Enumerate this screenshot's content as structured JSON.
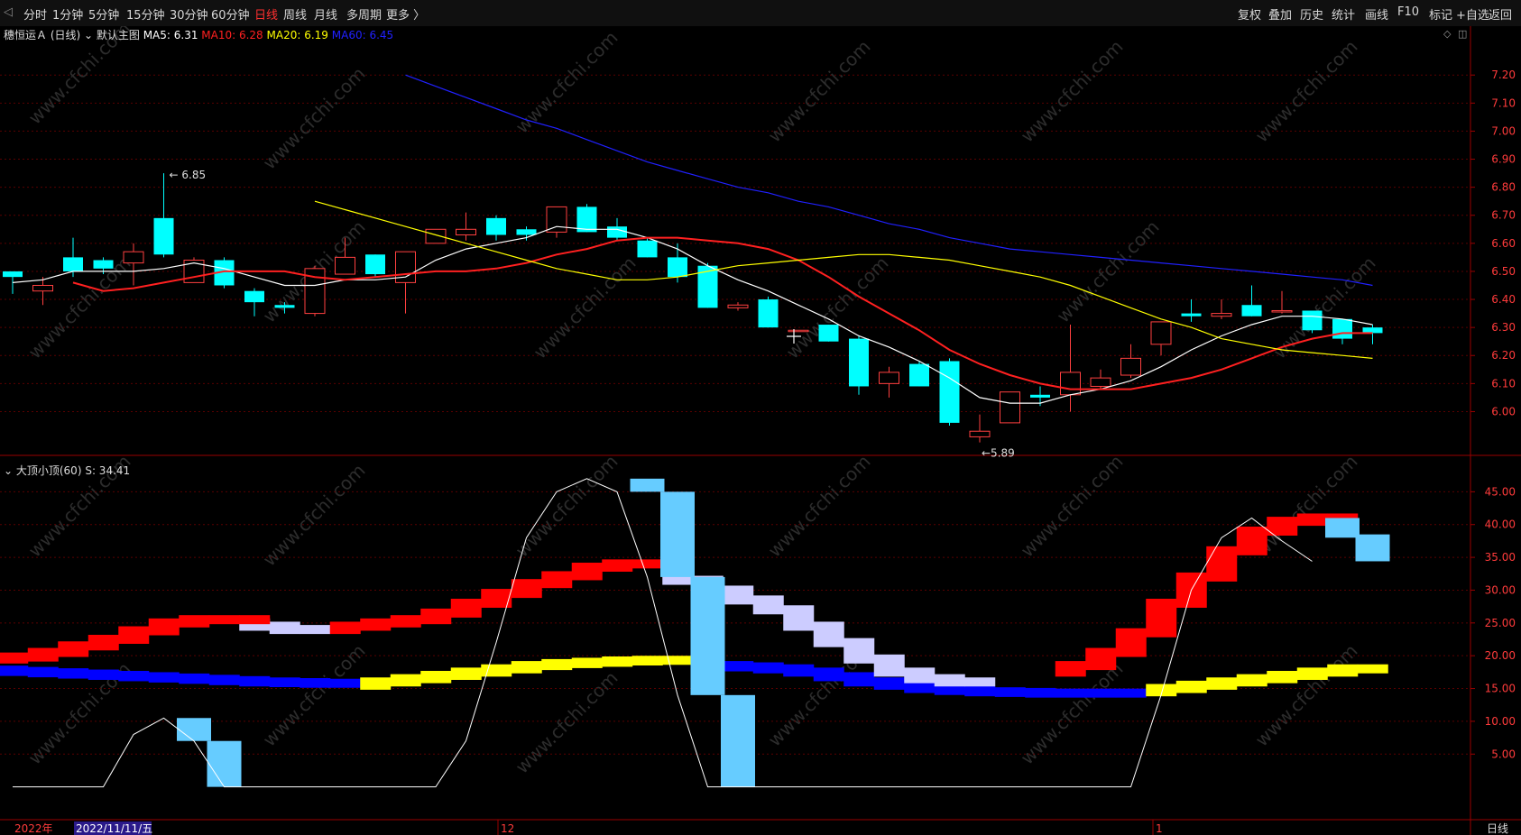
{
  "toolbar": {
    "left_items": [
      "分时",
      "1分钟",
      "5分钟",
      "15分钟",
      "30分钟",
      "60分钟",
      "日线",
      "周线",
      "月线",
      "多周期",
      "更多 〉"
    ],
    "active": "日线",
    "right_items": [
      "复权",
      "叠加",
      "历史",
      "统计",
      "画线",
      "F10",
      "标记",
      "+自选",
      "返回"
    ]
  },
  "main_header": {
    "name": "穗恒运Ａ (日线)",
    "template": "默认主图",
    "ma5": "MA5: 6.31",
    "ma10": "MA10: 6.28",
    "ma20": "MA20: 6.19",
    "ma60": "MA60: 6.45"
  },
  "sub_header": {
    "name": "大顶小顶(60)",
    "value": "S: 34.41"
  },
  "bottom_bar": {
    "year": "2022年",
    "date": "2022/11/11/五",
    "month_dec": "12",
    "month_jan": "1",
    "period": "日线"
  },
  "watermark": "www.cfchi.com",
  "colors": {
    "up": "#ff4040",
    "down": "#00ffff",
    "ma5": "#ffffff",
    "ma10": "#ff2020",
    "ma20": "#ffff00",
    "ma60": "#2020ff",
    "grid": "#5a0000",
    "axis": "#9a0000",
    "s_line": "#ffffff",
    "s_bar": "#66ccff",
    "red_band": "#ff0000",
    "lav_band": "#ccccff",
    "yel_band": "#ffff00",
    "blu_band": "#0000ff"
  },
  "chart_data": [
    {
      "type": "candlestick",
      "y_ticks": [
        6.0,
        6.1,
        6.2,
        6.3,
        6.4,
        6.5,
        6.6,
        6.7,
        6.8,
        6.9,
        7.0,
        7.1,
        7.2
      ],
      "ylim": [
        5.86,
        7.31
      ],
      "annotations": [
        {
          "label": "6.85",
          "index": 5,
          "value": 6.85
        },
        {
          "label": "5.89",
          "index": 32,
          "value": 5.89
        }
      ],
      "candles": [
        {
          "o": 6.5,
          "h": 6.5,
          "l": 6.42,
          "c": 6.48
        },
        {
          "o": 6.43,
          "h": 6.48,
          "l": 6.38,
          "c": 6.45
        },
        {
          "o": 6.55,
          "h": 6.62,
          "l": 6.48,
          "c": 6.5
        },
        {
          "o": 6.54,
          "h": 6.55,
          "l": 6.49,
          "c": 6.51
        },
        {
          "o": 6.53,
          "h": 6.6,
          "l": 6.45,
          "c": 6.57
        },
        {
          "o": 6.69,
          "h": 6.85,
          "l": 6.55,
          "c": 6.56
        },
        {
          "o": 6.46,
          "h": 6.55,
          "l": 6.46,
          "c": 6.54
        },
        {
          "o": 6.54,
          "h": 6.55,
          "l": 6.44,
          "c": 6.45
        },
        {
          "o": 6.43,
          "h": 6.44,
          "l": 6.34,
          "c": 6.39
        },
        {
          "o": 6.38,
          "h": 6.39,
          "l": 6.35,
          "c": 6.37
        },
        {
          "o": 6.35,
          "h": 6.52,
          "l": 6.34,
          "c": 6.51
        },
        {
          "o": 6.49,
          "h": 6.62,
          "l": 6.49,
          "c": 6.55
        },
        {
          "o": 6.56,
          "h": 6.56,
          "l": 6.48,
          "c": 6.49
        },
        {
          "o": 6.46,
          "h": 6.57,
          "l": 6.35,
          "c": 6.57
        },
        {
          "o": 6.6,
          "h": 6.65,
          "l": 6.6,
          "c": 6.65
        },
        {
          "o": 6.63,
          "h": 6.71,
          "l": 6.61,
          "c": 6.65
        },
        {
          "o": 6.69,
          "h": 6.7,
          "l": 6.61,
          "c": 6.63
        },
        {
          "o": 6.65,
          "h": 6.66,
          "l": 6.61,
          "c": 6.63
        },
        {
          "o": 6.64,
          "h": 6.73,
          "l": 6.62,
          "c": 6.73
        },
        {
          "o": 6.73,
          "h": 6.74,
          "l": 6.64,
          "c": 6.64
        },
        {
          "o": 6.66,
          "h": 6.69,
          "l": 6.61,
          "c": 6.62
        },
        {
          "o": 6.61,
          "h": 6.62,
          "l": 6.55,
          "c": 6.55
        },
        {
          "o": 6.55,
          "h": 6.6,
          "l": 6.46,
          "c": 6.48
        },
        {
          "o": 6.52,
          "h": 6.53,
          "l": 6.37,
          "c": 6.37
        },
        {
          "o": 6.37,
          "h": 6.39,
          "l": 6.36,
          "c": 6.38
        },
        {
          "o": 6.4,
          "h": 6.41,
          "l": 6.3,
          "c": 6.3
        },
        {
          "o": 6.29,
          "h": 6.29,
          "l": 6.29,
          "c": 6.29
        },
        {
          "o": 6.31,
          "h": 6.31,
          "l": 6.25,
          "c": 6.25
        },
        {
          "o": 6.26,
          "h": 6.27,
          "l": 6.06,
          "c": 6.09
        },
        {
          "o": 6.1,
          "h": 6.16,
          "l": 6.05,
          "c": 6.14
        },
        {
          "o": 6.17,
          "h": 6.18,
          "l": 6.09,
          "c": 6.09
        },
        {
          "o": 6.18,
          "h": 6.19,
          "l": 5.95,
          "c": 5.96
        },
        {
          "o": 5.91,
          "h": 5.99,
          "l": 5.89,
          "c": 5.93
        },
        {
          "o": 5.96,
          "h": 6.07,
          "l": 5.96,
          "c": 6.07
        },
        {
          "o": 6.06,
          "h": 6.09,
          "l": 6.02,
          "c": 6.05
        },
        {
          "o": 6.06,
          "h": 6.31,
          "l": 6.0,
          "c": 6.14
        },
        {
          "o": 6.09,
          "h": 6.15,
          "l": 6.08,
          "c": 6.12
        },
        {
          "o": 6.13,
          "h": 6.24,
          "l": 6.12,
          "c": 6.19
        },
        {
          "o": 6.24,
          "h": 6.32,
          "l": 6.2,
          "c": 6.32
        },
        {
          "o": 6.35,
          "h": 6.4,
          "l": 6.32,
          "c": 6.34
        },
        {
          "o": 6.34,
          "h": 6.4,
          "l": 6.33,
          "c": 6.35
        },
        {
          "o": 6.38,
          "h": 6.45,
          "l": 6.34,
          "c": 6.34
        },
        {
          "o": 6.36,
          "h": 6.43,
          "l": 6.35,
          "c": 6.36
        },
        {
          "o": 6.36,
          "h": 6.36,
          "l": 6.28,
          "c": 6.29
        },
        {
          "o": 6.33,
          "h": 6.33,
          "l": 6.24,
          "c": 6.26
        },
        {
          "o": 6.3,
          "h": 6.31,
          "l": 6.24,
          "c": 6.28
        }
      ],
      "series": [
        {
          "name": "MA5",
          "values": [
            6.46,
            6.47,
            6.5,
            6.5,
            6.5,
            6.51,
            6.53,
            6.51,
            6.48,
            6.45,
            6.45,
            6.47,
            6.47,
            6.48,
            6.54,
            6.58,
            6.6,
            6.62,
            6.66,
            6.65,
            6.65,
            6.62,
            6.58,
            6.52,
            6.47,
            6.43,
            6.38,
            6.33,
            6.27,
            6.23,
            6.18,
            6.12,
            6.05,
            6.03,
            6.03,
            6.06,
            6.08,
            6.11,
            6.16,
            6.22,
            6.27,
            6.31,
            6.34,
            6.34,
            6.33,
            6.31
          ]
        },
        {
          "name": "MA10",
          "values": [
            6.46,
            6.43,
            6.44,
            6.46,
            6.48,
            6.5,
            6.5,
            6.5,
            6.48,
            6.47,
            6.48,
            6.49,
            6.5,
            6.5,
            6.51,
            6.53,
            6.56,
            6.58,
            6.61,
            6.62,
            6.62,
            6.61,
            6.6,
            6.58,
            6.54,
            6.48,
            6.41,
            6.35,
            6.29,
            6.22,
            6.17,
            6.13,
            6.1,
            6.08,
            6.08,
            6.08,
            6.1,
            6.12,
            6.15,
            6.19,
            6.23,
            6.26,
            6.28,
            6.28
          ]
        },
        {
          "name": "MA20",
          "values": [
            6.75,
            6.72,
            6.69,
            6.66,
            6.63,
            6.6,
            6.57,
            6.54,
            6.51,
            6.49,
            6.47,
            6.47,
            6.48,
            6.5,
            6.52,
            6.53,
            6.54,
            6.55,
            6.56,
            6.56,
            6.55,
            6.54,
            6.52,
            6.5,
            6.48,
            6.45,
            6.41,
            6.37,
            6.33,
            6.3,
            6.26,
            6.24,
            6.22,
            6.21,
            6.2,
            6.19
          ]
        },
        {
          "name": "MA60",
          "values": [
            7.2,
            7.16,
            7.12,
            7.08,
            7.04,
            7.01,
            6.97,
            6.93,
            6.89,
            6.86,
            6.83,
            6.8,
            6.78,
            6.75,
            6.73,
            6.7,
            6.67,
            6.65,
            6.62,
            6.6,
            6.58,
            6.57,
            6.56,
            6.55,
            6.54,
            6.53,
            6.52,
            6.51,
            6.5,
            6.49,
            6.48,
            6.47,
            6.45
          ]
        }
      ]
    },
    {
      "type": "bar+line",
      "title": "大顶小顶(60)",
      "y_ticks": [
        5,
        10,
        15,
        20,
        25,
        30,
        35,
        40,
        45
      ],
      "ylim": [
        -5,
        50
      ],
      "s_line": [
        0,
        0,
        0,
        0,
        8,
        10.5,
        7,
        0,
        0,
        0,
        0,
        0,
        0,
        0,
        0,
        7,
        22,
        38,
        45,
        47,
        45,
        32,
        14,
        0,
        0,
        0,
        0,
        0,
        0,
        0,
        0,
        0,
        0,
        0,
        0,
        0,
        0,
        0,
        14,
        30,
        38,
        41,
        37.5,
        34.4
      ],
      "s_bars": [
        {
          "i": 6,
          "top": 10.5,
          "bottom": 7
        },
        {
          "i": 7,
          "top": 7,
          "bottom": 0
        },
        {
          "i": 21,
          "top": 47,
          "bottom": 45
        },
        {
          "i": 22,
          "top": 45,
          "bottom": 32
        },
        {
          "i": 23,
          "top": 32,
          "bottom": 14
        },
        {
          "i": 24,
          "top": 14,
          "bottom": 0
        },
        {
          "i": 44,
          "top": 41,
          "bottom": 38
        },
        {
          "i": 45,
          "top": 38.5,
          "bottom": 34.4
        }
      ],
      "red_band": [
        19.5,
        19.8,
        20.5,
        21.5,
        22.5,
        23.8,
        25,
        25.5,
        25.5,
        null,
        null,
        24,
        24.5,
        25,
        25.5,
        26.5,
        28,
        29.5,
        31,
        32.2,
        33.5,
        34,
        null,
        null,
        null,
        null,
        null,
        null,
        null,
        null,
        null,
        null,
        null,
        null,
        null,
        17.5,
        18.5,
        20.5,
        23.5,
        28,
        32,
        36,
        39,
        40.5,
        41
      ],
      "lav_band": [
        null,
        null,
        null,
        null,
        null,
        null,
        null,
        null,
        25,
        24.5,
        24,
        null,
        null,
        null,
        null,
        null,
        null,
        null,
        null,
        null,
        null,
        null,
        32.5,
        31.5,
        30,
        28.5,
        27,
        24.5,
        22,
        19.5,
        17.5,
        16.5,
        16
      ],
      "yel_band": [
        null,
        null,
        null,
        null,
        null,
        null,
        null,
        null,
        null,
        null,
        null,
        null,
        15.5,
        16,
        16.5,
        17,
        17.5,
        18,
        18.5,
        18.8,
        19,
        19.2,
        19.3,
        19.3,
        null,
        null,
        null,
        null,
        null,
        null,
        null,
        null,
        null,
        null,
        null,
        null,
        null,
        null,
        14.5,
        15,
        15.5,
        16,
        16.5,
        17,
        17.5,
        18
      ],
      "blu_band": [
        17.8,
        17.6,
        17.4,
        17.2,
        17,
        16.8,
        16.6,
        16.4,
        16.2,
        16,
        15.9,
        15.8,
        15.8,
        null,
        null,
        null,
        null,
        null,
        null,
        null,
        null,
        null,
        null,
        null,
        18.5,
        18.3,
        18,
        17.5,
        16.8,
        16,
        15.5,
        15,
        14.7,
        14.5,
        14.4,
        14.3,
        14.3,
        14.3
      ]
    }
  ]
}
